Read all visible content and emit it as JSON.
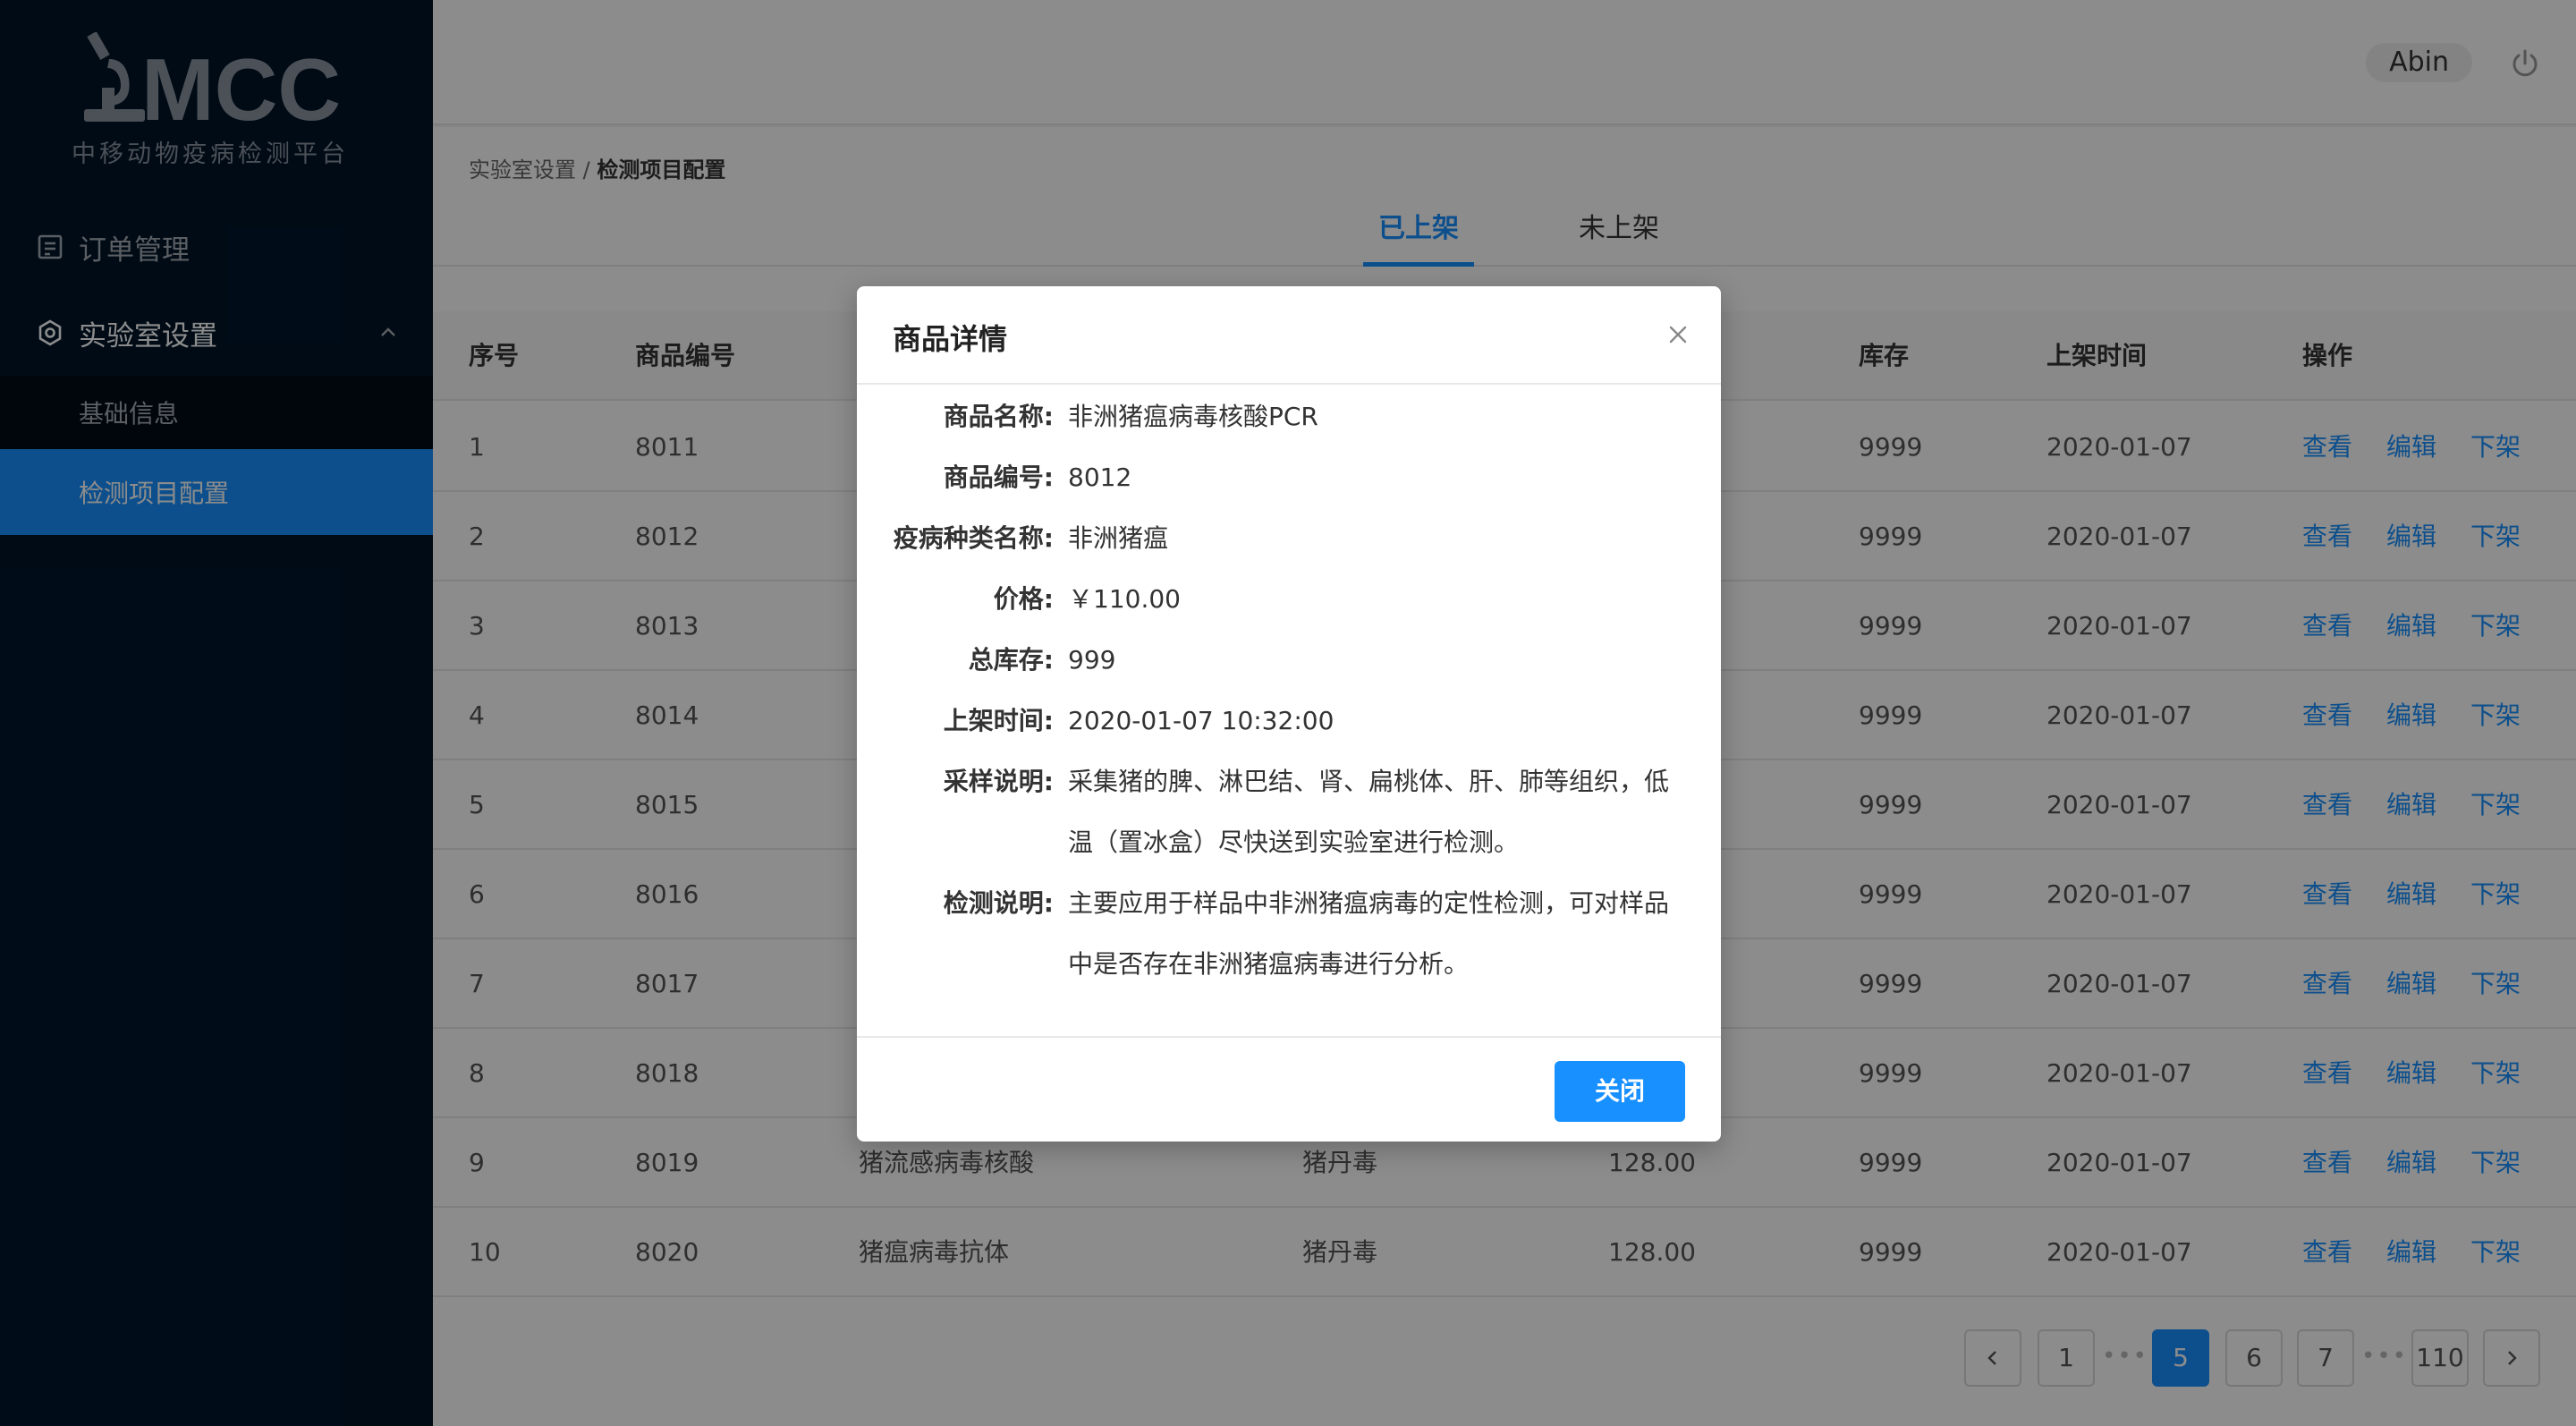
{
  "brand": {
    "logo_text": "MCC",
    "subtitle": "中移动物疫病检测平台"
  },
  "sidebar": {
    "items": [
      {
        "label": "订单管理",
        "icon": "order-list-icon"
      },
      {
        "label": "实验室设置",
        "icon": "settings-icon",
        "expanded": true,
        "children": [
          {
            "label": "基础信息"
          },
          {
            "label": "检测项目配置",
            "selected": true
          }
        ]
      }
    ]
  },
  "header": {
    "user_name": "Abin",
    "logout_icon": "power-icon"
  },
  "breadcrumb": {
    "parent": "实验室设置",
    "separator": " / ",
    "current": "检测项目配置"
  },
  "tabs": [
    {
      "label": "已上架",
      "active": true
    },
    {
      "label": "未上架",
      "active": false
    }
  ],
  "table": {
    "columns": {
      "seq": "序号",
      "code": "商品编号",
      "stock": "库存",
      "time": "上架时间",
      "actions": "操作"
    },
    "action_labels": [
      "查看",
      "编辑",
      "下架"
    ],
    "rows": [
      {
        "seq": "1",
        "code": "8011",
        "name": "",
        "type": "",
        "price": "",
        "stock": "9999",
        "time": "2020-01-07"
      },
      {
        "seq": "2",
        "code": "8012",
        "name": "",
        "type": "",
        "price": "",
        "stock": "9999",
        "time": "2020-01-07"
      },
      {
        "seq": "3",
        "code": "8013",
        "name": "",
        "type": "",
        "price": "",
        "stock": "9999",
        "time": "2020-01-07"
      },
      {
        "seq": "4",
        "code": "8014",
        "name": "",
        "type": "",
        "price": "",
        "stock": "9999",
        "time": "2020-01-07"
      },
      {
        "seq": "5",
        "code": "8015",
        "name": "",
        "type": "",
        "price": "",
        "stock": "9999",
        "time": "2020-01-07"
      },
      {
        "seq": "6",
        "code": "8016",
        "name": "",
        "type": "",
        "price": "",
        "stock": "9999",
        "time": "2020-01-07"
      },
      {
        "seq": "7",
        "code": "8017",
        "name": "",
        "type": "",
        "price": "",
        "stock": "9999",
        "time": "2020-01-07"
      },
      {
        "seq": "8",
        "code": "8018",
        "name": "",
        "type": "",
        "price": "",
        "stock": "9999",
        "time": "2020-01-07"
      },
      {
        "seq": "9",
        "code": "8019",
        "name": "猪流感病毒核酸",
        "type": "猪丹毒",
        "price": "128.00",
        "stock": "9999",
        "time": "2020-01-07"
      },
      {
        "seq": "10",
        "code": "8020",
        "name": "猪瘟病毒抗体",
        "type": "猪丹毒",
        "price": "128.00",
        "stock": "9999",
        "time": "2020-01-07"
      }
    ]
  },
  "pagination": {
    "prev_icon": "chevron-left-icon",
    "next_icon": "chevron-right-icon",
    "pages": [
      "1",
      "5",
      "6",
      "7",
      "110"
    ],
    "ellipsis": "•••",
    "current": "5"
  },
  "modal": {
    "title": "商品详情",
    "close_icon": "close-icon",
    "fields": [
      {
        "label": "商品名称:",
        "value": "非洲猪瘟病毒核酸PCR"
      },
      {
        "label": "商品编号:",
        "value": "8012"
      },
      {
        "label": "疫病种类名称:",
        "value": "非洲猪瘟"
      },
      {
        "label": "价格:",
        "value": "￥110.00"
      },
      {
        "label": "总库存:",
        "value": "999"
      },
      {
        "label": "上架时间:",
        "value": "2020-01-07 10:32:00"
      },
      {
        "label": "采样说明:",
        "value": "采集猪的脾、淋巴结、肾、扁桃体、肝、肺等组织，低温（置冰盒）尽快送到实验室进行检测。"
      },
      {
        "label": "检测说明:",
        "value": "主要应用于样品中非洲猪瘟病毒的定性检测，可对样品中是否存在非洲猪瘟病毒进行分析。"
      }
    ],
    "close_button": "关闭"
  },
  "colors": {
    "primary": "#1890ff",
    "sidebar_bg": "#001529",
    "submenu_bg": "#000c17"
  }
}
